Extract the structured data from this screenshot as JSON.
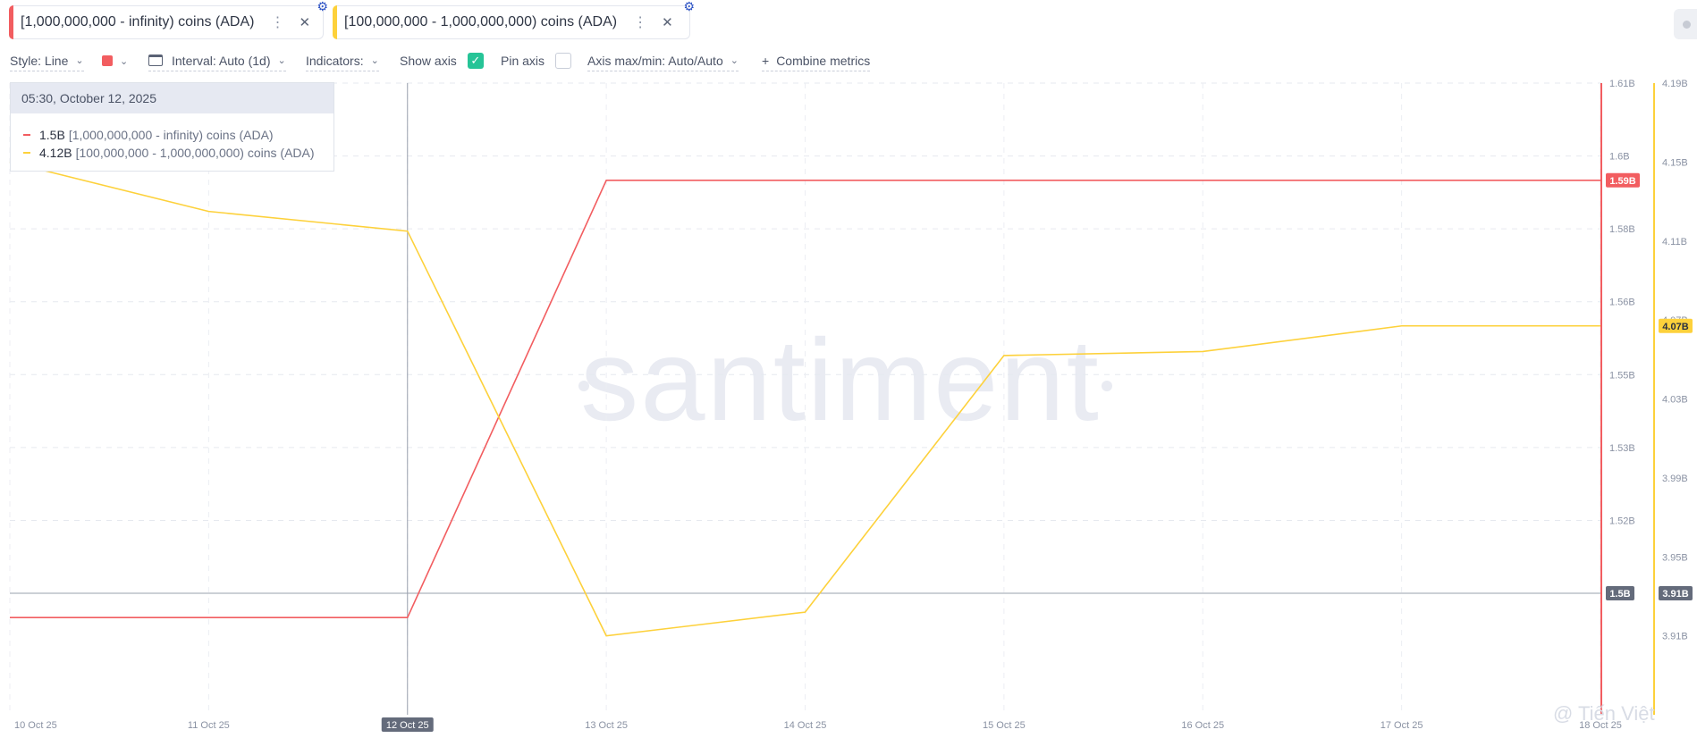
{
  "tabs": [
    {
      "label": "[1,000,000,000 - infinity) coins (ADA)",
      "color": "#f25d60"
    },
    {
      "label": "[100,000,000 - 1,000,000,000) coins (ADA)",
      "color": "#fdd13b"
    }
  ],
  "toolbar": {
    "style": "Style: Line",
    "interval": "Interval: Auto (1d)",
    "indicators": "Indicators:",
    "show_axis": "Show axis",
    "pin_axis": "Pin axis",
    "axis_maxmin": "Axis max/min: Auto/Auto",
    "combine": "Combine metrics",
    "combine_plus": "+"
  },
  "tooltip": {
    "date": "05:30, October 12, 2025",
    "rows": [
      {
        "value": "1.5B",
        "label": "[1,000,000,000 - infinity) coins (ADA)"
      },
      {
        "value": "4.12B",
        "label": "[100,000,000 - 1,000,000,000) coins (ADA)"
      }
    ]
  },
  "watermark_text": "santiment",
  "footer_watermark": "@ Tiến Việt",
  "chart_data": {
    "type": "line",
    "x": [
      "10 Oct 25",
      "11 Oct 25",
      "12 Oct 25",
      "13 Oct 25",
      "14 Oct 25",
      "15 Oct 25",
      "16 Oct 25",
      "17 Oct 25",
      "18 Oct 25"
    ],
    "highlight_x": "12 Oct 25",
    "series": [
      {
        "name": "[1,000,000,000 - infinity) coins (ADA)",
        "color": "#f25d60",
        "values": [
          1.5,
          1.5,
          1.5,
          1.59,
          1.59,
          1.59,
          1.59,
          1.59,
          1.59
        ],
        "axis": "left",
        "last_badge": "1.59B"
      },
      {
        "name": "[100,000,000 - 1,000,000,000) coins (ADA)",
        "color": "#fdd13b",
        "values": [
          4.15,
          4.125,
          4.115,
          3.91,
          3.922,
          4.052,
          4.054,
          4.067,
          4.067
        ],
        "axis": "right",
        "last_badge": "4.07B"
      }
    ],
    "axis1": {
      "ylim": [
        1.48,
        1.61
      ],
      "ticks": [
        "1.61B",
        "1.6B",
        "1.58B",
        "1.56B",
        "1.55B",
        "1.53B",
        "1.52B",
        "1.5B"
      ],
      "tick_values": [
        1.61,
        1.595,
        1.58,
        1.565,
        1.55,
        1.535,
        1.52,
        1.505
      ],
      "crosshair_badge": "1.5B"
    },
    "axis2": {
      "ylim": [
        3.87,
        4.19
      ],
      "ticks": [
        "4.19B",
        "4.15B",
        "4.11B",
        "4.07B",
        "4.03B",
        "3.99B",
        "3.95B",
        "3.91B"
      ],
      "tick_values": [
        4.19,
        4.15,
        4.11,
        4.07,
        4.03,
        3.99,
        3.95,
        3.91
      ],
      "crosshair_badge": "3.91B"
    },
    "crosshair_y_left": 1.505,
    "grid": true,
    "legend": "none"
  }
}
